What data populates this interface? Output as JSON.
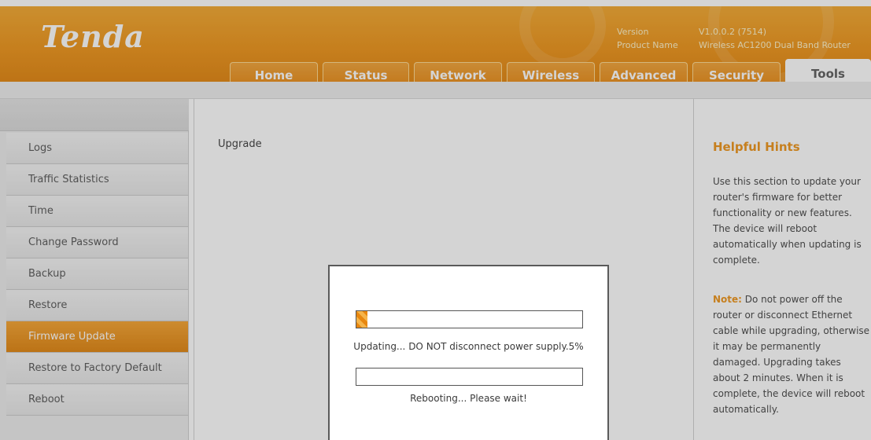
{
  "brand": {
    "logo": "Tenda",
    "accent": "#ee9316"
  },
  "version_info": {
    "version_label": "Version",
    "version_value": "V1.0.0.2 (7514)",
    "product_label": "Product Name",
    "product_value": "Wireless AC1200 Dual Band Router"
  },
  "tabs": [
    {
      "label": "Home"
    },
    {
      "label": "Status"
    },
    {
      "label": "Network"
    },
    {
      "label": "Wireless"
    },
    {
      "label": "Advanced"
    },
    {
      "label": "Security"
    },
    {
      "label": "Tools"
    }
  ],
  "active_tab": "Tools",
  "sidebar": {
    "items": [
      {
        "label": "Logs"
      },
      {
        "label": "Traffic Statistics"
      },
      {
        "label": "Time"
      },
      {
        "label": "Change Password"
      },
      {
        "label": "Backup"
      },
      {
        "label": "Restore"
      },
      {
        "label": "Firmware Update"
      },
      {
        "label": "Restore to Factory Default"
      },
      {
        "label": "Reboot"
      }
    ],
    "active": "Firmware Update"
  },
  "content": {
    "title": "Upgrade"
  },
  "hints": {
    "title": "Helpful Hints",
    "text": "Use this section to update your router's firmware for better functionality or new features. The device will reboot automatically when updating is complete.",
    "note_label": "Note:",
    "note_text": " Do not power off the router or disconnect Ethernet cable while upgrading, otherwise it may be permanently damaged. Upgrading takes about 2 minutes. When it is complete, the device will reboot automatically."
  },
  "upgrade_dialog": {
    "update_progress_fraction": 0.05,
    "update_message": "Updating... DO NOT disconnect power supply.5%",
    "reboot_progress_fraction": 0,
    "reboot_message": "Rebooting... Please wait!"
  }
}
